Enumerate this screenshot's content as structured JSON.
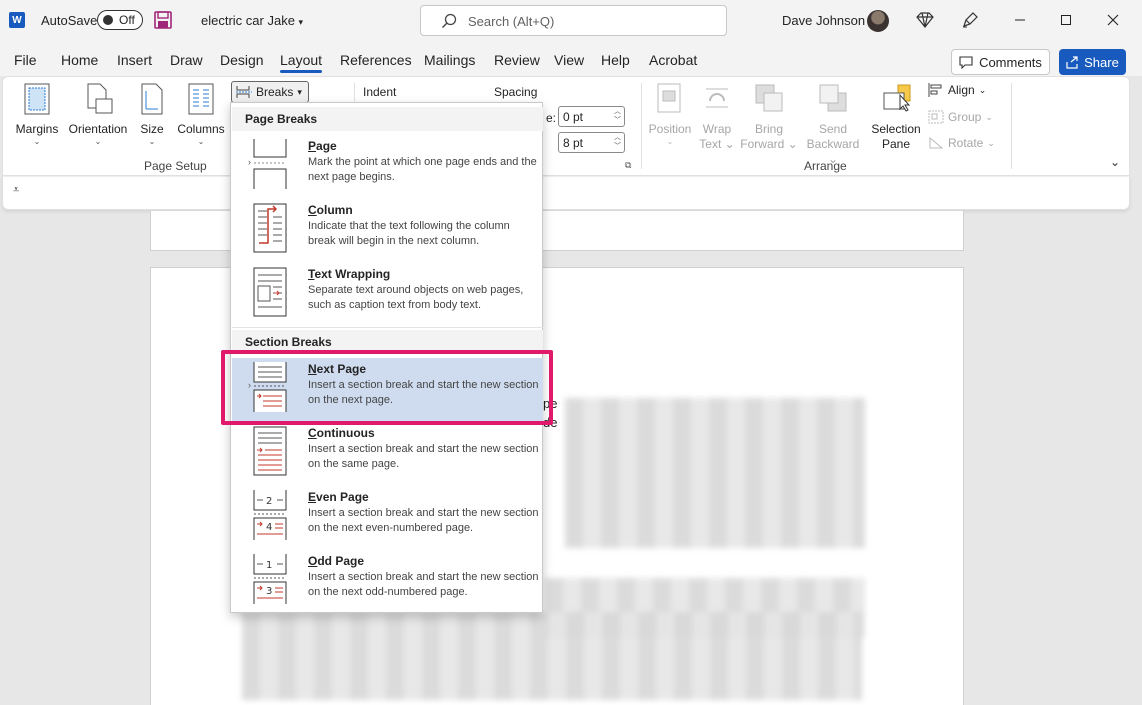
{
  "titlebar": {
    "app_logo": "W",
    "autosave_label": "AutoSave",
    "autosave_state": "Off",
    "doc_title": "electric car Jake",
    "search_placeholder": "Search (Alt+Q)",
    "user_name": "Dave Johnson"
  },
  "tabs": [
    "File",
    "Home",
    "Insert",
    "Draw",
    "Design",
    "Layout",
    "References",
    "Mailings",
    "Review",
    "View",
    "Help",
    "Acrobat"
  ],
  "active_tab": "Layout",
  "actions": {
    "comments": "Comments",
    "share": "Share"
  },
  "ribbon": {
    "margins": "Margins",
    "orientation": "Orientation",
    "size": "Size",
    "columns": "Columns",
    "breaks": "Breaks",
    "page_setup": "Page Setup",
    "indent": "Indent",
    "spacing": "Spacing",
    "before_suffix": "e:",
    "before_value": "0 pt",
    "after_value": "8 pt",
    "position": "Position",
    "wrap_text_1": "Wrap",
    "wrap_text_2": "Text",
    "bring_forward_1": "Bring",
    "bring_forward_2": "Forward",
    "send_backward_1": "Send",
    "send_backward_2": "Backward",
    "selection_pane_1": "Selection",
    "selection_pane_2": "Pane",
    "align": "Align",
    "group": "Group",
    "rotate": "Rotate",
    "arrange": "Arrange"
  },
  "dropdown": {
    "page_breaks_header": "Page Breaks",
    "section_breaks_header": "Section Breaks",
    "items": [
      {
        "key": "P",
        "rest": "age",
        "desc": "Mark the point at which one page ends and the next page begins."
      },
      {
        "key": "C",
        "rest": "olumn",
        "desc": "Indicate that the text following the column break will begin in the next column."
      },
      {
        "key": "T",
        "rest": "ext Wrapping",
        "desc": "Separate text around objects on web pages, such as caption text from body text."
      },
      {
        "key": "N",
        "rest": "ext Page",
        "desc": "Insert a section break and start the new section on the next page."
      },
      {
        "key": "C",
        "rest": "ontinuous",
        "desc": "Insert a section break and start the new section on the same page."
      },
      {
        "key": "E",
        "rest": "ven Page",
        "desc": "Insert a section break and start the new section on the next even-numbered page."
      },
      {
        "key": "O",
        "rest": "dd Page",
        "desc": "Insert a section break and start the new section on the next odd-numbered page."
      }
    ]
  },
  "document_fragments": [
    "pe",
    "de"
  ],
  "colors": {
    "accent": "#185abd",
    "highlight": "#e0196b",
    "selected_item": "#cfdcf0"
  }
}
